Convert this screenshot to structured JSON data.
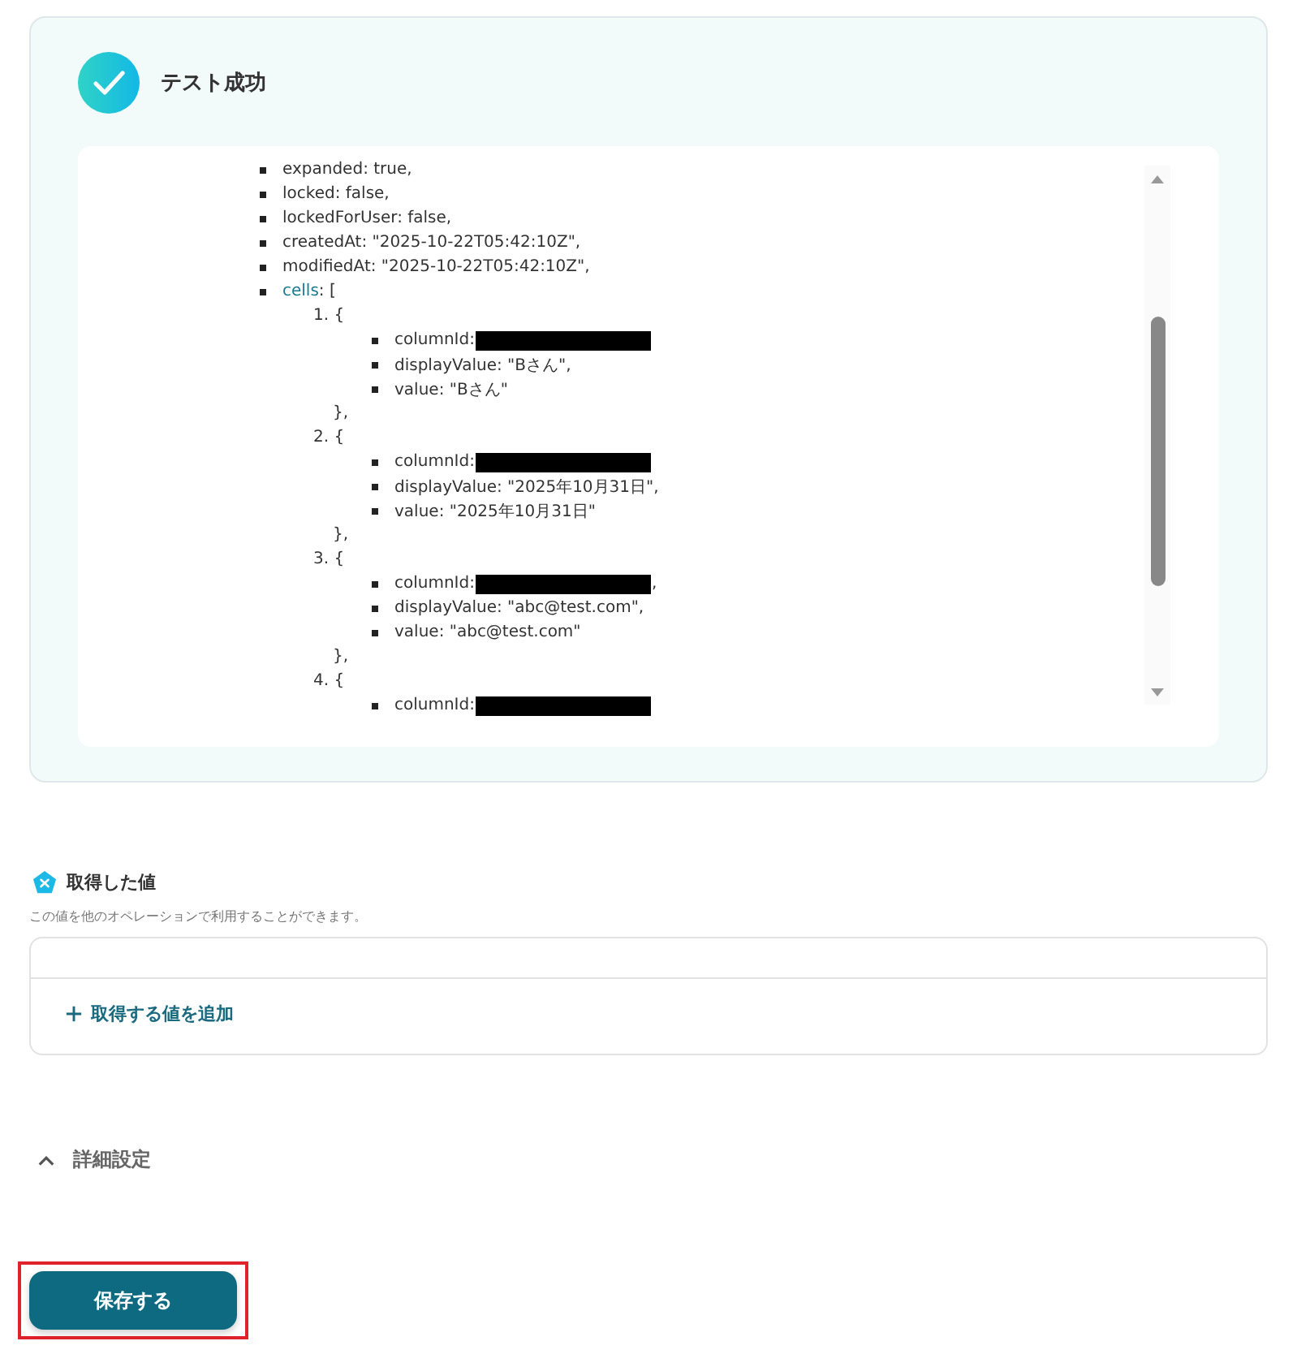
{
  "result": {
    "title": "テスト成功",
    "lines": [
      {
        "key": "expanded",
        "value": ": true,"
      },
      {
        "key": "locked",
        "value": ": false,"
      },
      {
        "key": "lockedForUser",
        "value": ": false,"
      },
      {
        "key": "createdAt",
        "value": ": \"2025-10-22T05:42:10Z\","
      },
      {
        "key": "modifiedAt",
        "value": ": \"2025-10-22T05:42:10Z\","
      },
      {
        "key": "cells",
        "value": ": [",
        "highlight": true,
        "children": [
          {
            "number": "1.",
            "open": "{",
            "close": "},",
            "children": [
              {
                "key": "columnId",
                "value": ":",
                "redacted": true
              },
              {
                "key": "displayValue",
                "value": ": \"Bさん\","
              },
              {
                "key": "value",
                "value": ": \"Bさん\""
              }
            ]
          },
          {
            "number": "2.",
            "open": "{",
            "close": "},",
            "children": [
              {
                "key": "columnId",
                "value": ":",
                "redacted": true
              },
              {
                "key": "displayValue",
                "value": ": \"2025年10月31日\","
              },
              {
                "key": "value",
                "value": ": \"2025年10月31日\""
              }
            ]
          },
          {
            "number": "3.",
            "open": "{",
            "close": "},",
            "children": [
              {
                "key": "columnId",
                "value": ":",
                "redacted": true,
                "after": ","
              },
              {
                "key": "displayValue",
                "value": ": \"abc@test.com\","
              },
              {
                "key": "value",
                "value": ": \"abc@test.com\""
              }
            ]
          },
          {
            "number": "4.",
            "open": "{",
            "children": [
              {
                "key": "columnId",
                "value": ":",
                "redacted": true
              }
            ]
          }
        ]
      }
    ]
  },
  "values": {
    "title": "取得した値",
    "description": "この値を他のオペレーションで利用することができます。",
    "add_label": "取得する値を追加"
  },
  "advanced": {
    "label": "詳細設定",
    "expanded": true
  },
  "save_button": "保存する"
}
